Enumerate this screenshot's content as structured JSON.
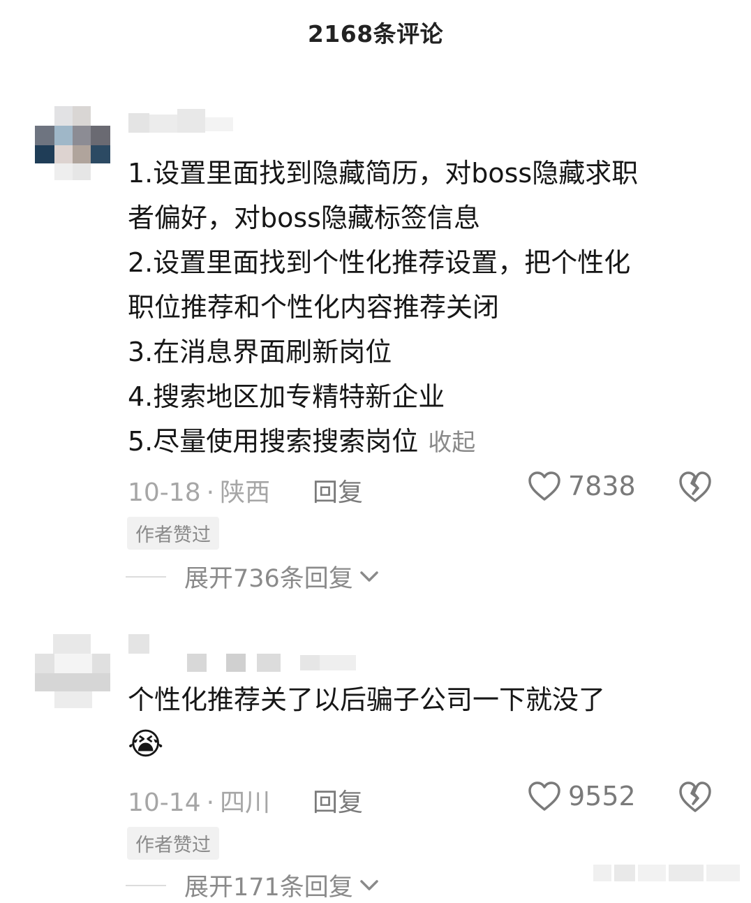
{
  "header": {
    "title": "2168条评论"
  },
  "comments": [
    {
      "lines": [
        "1.设置里面找到隐藏简历，对boss隐藏求职",
        "者偏好，对boss隐藏标签信息",
        "2.设置里面找到个性化推荐设置，把个性化",
        "职位推荐和个性化内容推荐关闭",
        "3.在消息界面刷新岗位",
        "4.搜索地区加专精特新企业",
        "5.尽量使用搜索搜索岗位"
      ],
      "collapse_label": "收起",
      "date": "10-18",
      "location": "陕西",
      "reply_label": "回复",
      "likes": "7838",
      "badge": "作者赞过",
      "expand_label": "展开736条回复"
    },
    {
      "lines": [
        "个性化推荐关了以后骗子公司一下就没了"
      ],
      "emoji": "😭",
      "date": "10-14",
      "location": "四川",
      "reply_label": "回复",
      "likes": "9552",
      "badge": "作者赞过",
      "expand_label": "展开171条回复"
    }
  ],
  "colors": {
    "meta_gray": "#a6a6a6",
    "text": "#161616",
    "badge_bg": "#f1f1f1"
  }
}
